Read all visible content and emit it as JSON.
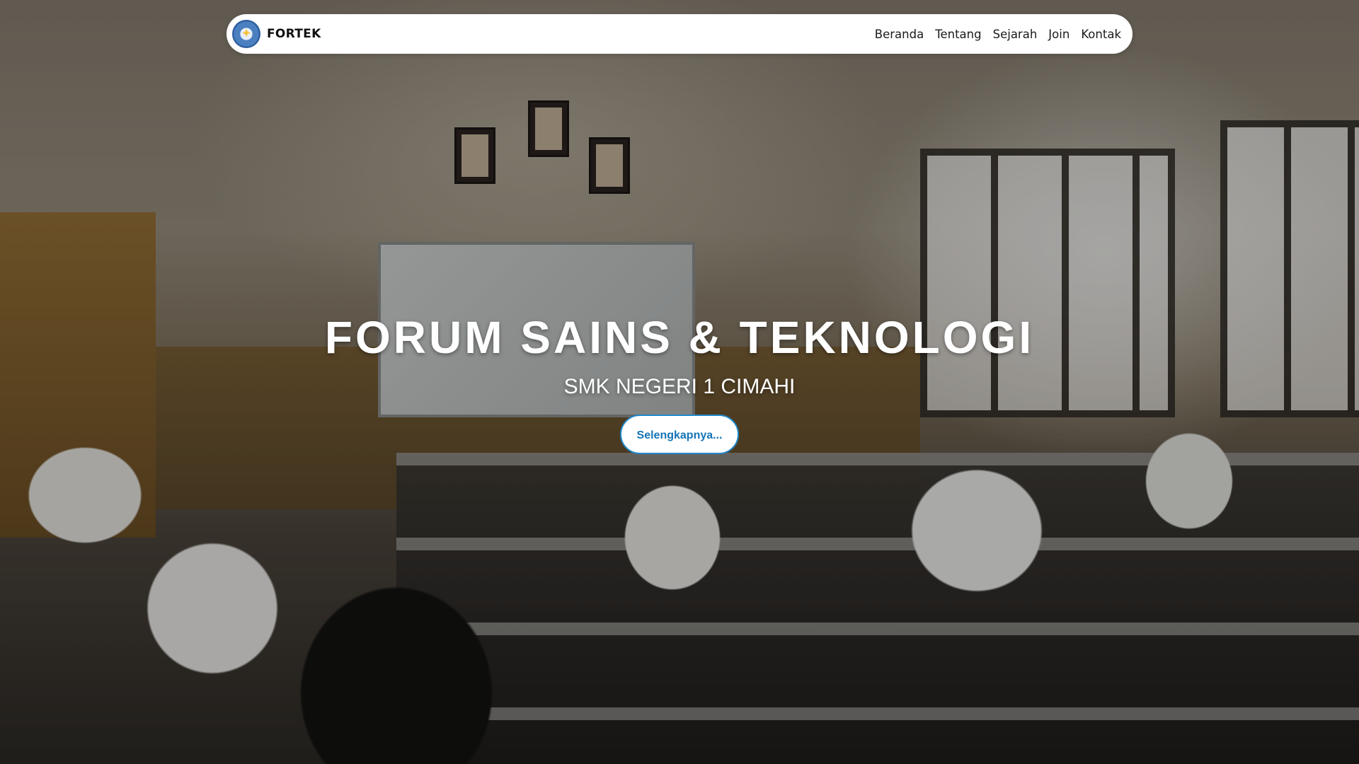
{
  "navbar": {
    "brand_name": "FORTEK",
    "logo_icon": "school-emblem-icon",
    "links": [
      {
        "label": "Beranda"
      },
      {
        "label": "Tentang"
      },
      {
        "label": "Sejarah"
      },
      {
        "label": "Join"
      },
      {
        "label": "Kontak"
      }
    ]
  },
  "hero": {
    "title": "FORUM SAINS & TEKNOLOGI",
    "subtitle": "SMK NEGERI 1 CIMAHI",
    "button_label": "Selengkapnya...",
    "background_image": "classroom-photo"
  },
  "colors": {
    "accent": "#1e88c9",
    "navbar_bg": "#ffffff",
    "hero_text": "#ffffff"
  }
}
